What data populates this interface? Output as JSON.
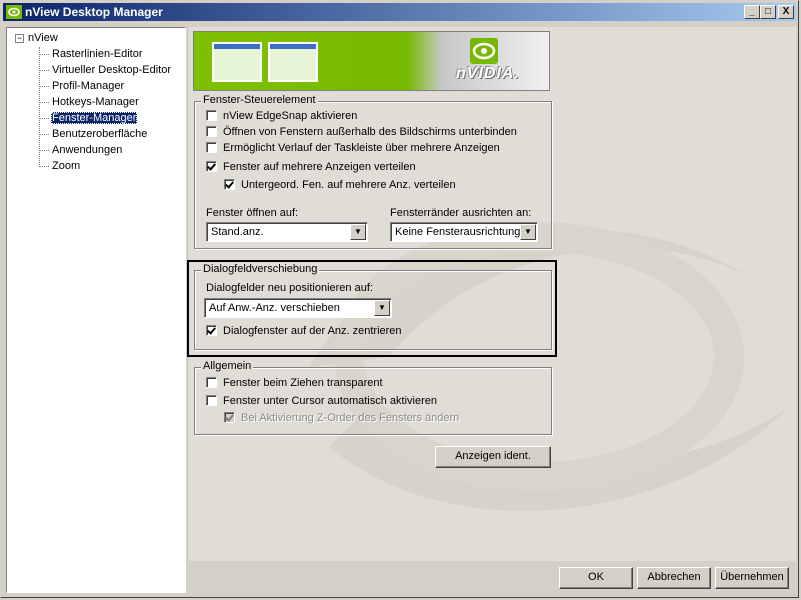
{
  "window": {
    "title": "nView Desktop Manager",
    "controls": {
      "minimize": "_",
      "maximize": "□",
      "close": "X"
    }
  },
  "tree": {
    "root": {
      "expander": "−",
      "label": "nView"
    },
    "items": [
      {
        "label": "Rasterlinien-Editor",
        "selected": false
      },
      {
        "label": "Virtueller Desktop-Editor",
        "selected": false
      },
      {
        "label": "Profil-Manager",
        "selected": false
      },
      {
        "label": "Hotkeys-Manager",
        "selected": false
      },
      {
        "label": "Fenster-Manager",
        "selected": true
      },
      {
        "label": "Benutzeroberfläche",
        "selected": false
      },
      {
        "label": "Anwendungen",
        "selected": false
      },
      {
        "label": "Zoom",
        "selected": false
      }
    ]
  },
  "banner": {
    "logo_text": "nVIDIA."
  },
  "fenster_steuerelement": {
    "legend": "Fenster-Steuerelement",
    "checkboxes": [
      {
        "label": "nView EdgeSnap aktivieren",
        "checked": false
      },
      {
        "label": "Öffnen von Fenstern außerhalb des Bildschirms unterbinden",
        "checked": false
      },
      {
        "label": "Ermöglicht Verlauf der Taskleiste über mehrere Anzeigen",
        "checked": false
      },
      {
        "label": "Fenster auf mehrere Anzeigen verteilen",
        "checked": true
      },
      {
        "label": "Untergeord. Fen. auf mehrere Anz. verteilen",
        "checked": true
      }
    ],
    "open_on_label": "Fenster öffnen auf:",
    "open_on_value": "Stand.anz.",
    "align_label": "Fensterränder ausrichten an:",
    "align_value": "Keine Fensterausrichtung"
  },
  "dialog_verschiebung": {
    "legend": "Dialogfeldverschiebung",
    "reposition_label": "Dialogfelder neu positionieren auf:",
    "reposition_value": "Auf Anw.-Anz. verschieben",
    "center_checkbox": {
      "label": "Dialogfenster auf der Anz. zentrieren",
      "checked": true
    }
  },
  "allgemein": {
    "legend": "Allgemein",
    "checkboxes": [
      {
        "label": "Fenster beim Ziehen transparent",
        "checked": false,
        "disabled": false
      },
      {
        "label": "Fenster unter Cursor automatisch aktivieren",
        "checked": false,
        "disabled": false
      },
      {
        "label": "Bei Aktivierung Z-Order des Fensters ändern",
        "checked": true,
        "disabled": true
      }
    ]
  },
  "buttons": {
    "identify": "Anzeigen ident.",
    "ok": "OK",
    "cancel": "Abbrechen",
    "apply": "Übernehmen"
  },
  "colors": {
    "title_bar_start": "#0a246a",
    "title_bar_end": "#a6caf0",
    "nvidia_green": "#76b900",
    "selection": "#0a246a"
  }
}
